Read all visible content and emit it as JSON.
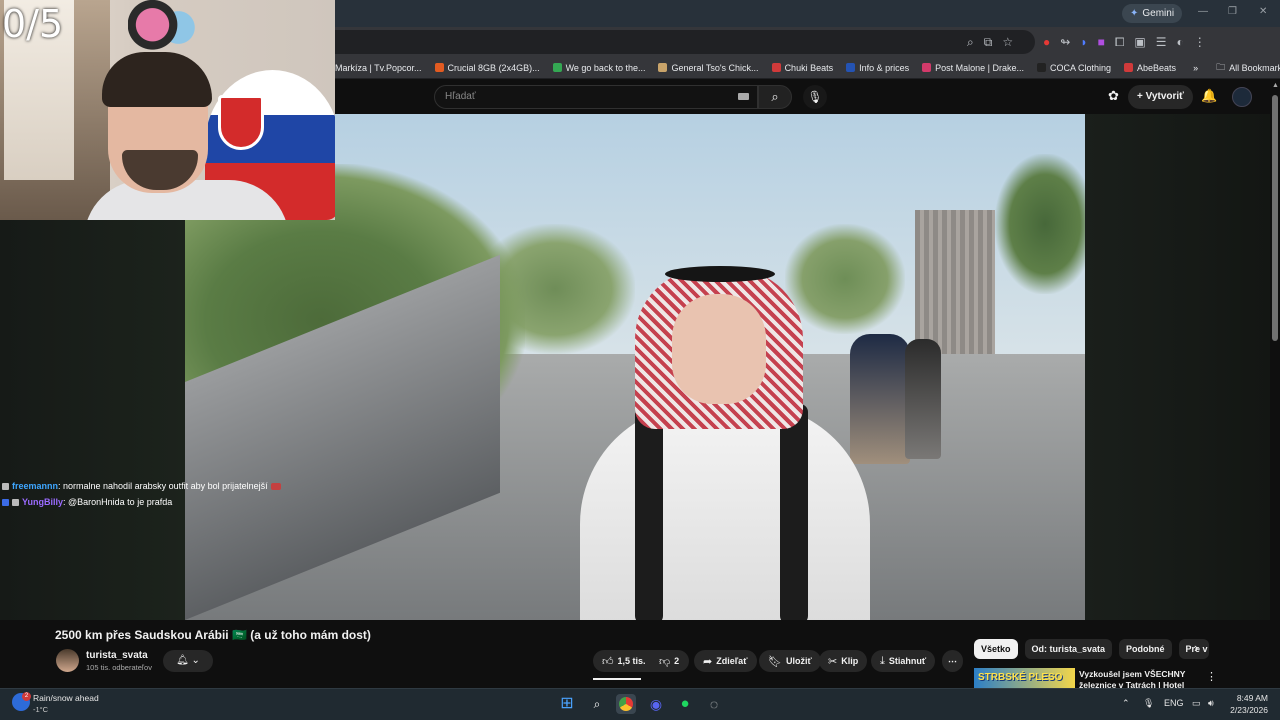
{
  "overlay": {
    "counter": "0/5"
  },
  "browser": {
    "gemini_label": "Gemini",
    "bookmarks": [
      {
        "label": "Markíza | Tv.Popcor...",
        "color": "#3aa1e0"
      },
      {
        "label": "Crucial 8GB (2x4GB)...",
        "color": "#e25b21"
      },
      {
        "label": "We go back to the...",
        "color": "#34a853"
      },
      {
        "label": "General Tso's Chick...",
        "color": "#c9a46a"
      },
      {
        "label": "Chuki Beats",
        "color": "#d03a3a"
      },
      {
        "label": "Info & prices",
        "color": "#2453b3"
      },
      {
        "label": "Post Malone | Drake...",
        "color": "#d23a6a"
      },
      {
        "label": "COCA Clothing",
        "color": "#222222"
      },
      {
        "label": "AbeBeats",
        "color": "#d03a3a"
      }
    ],
    "all_bookmarks": "All Bookmarks"
  },
  "youtube": {
    "search_placeholder": "Hľadať",
    "create_label": "Vytvoriť",
    "video_title": "2500 km přes Saudskou Arábii 🇸🇦 (a už toho mám dost)",
    "channel_name": "turista_svata",
    "channel_subs": "105 tis. odberateľov",
    "likes": "1,5 tis.",
    "dislikes": "2",
    "share": "Zdieľať",
    "save": "Uložiť",
    "clip": "Klip",
    "download": "Stiahnuť",
    "chips": [
      "Všetko",
      "Od: turista_svata",
      "Podobné",
      "Pre v"
    ],
    "rec_thumb_text": "STRBSKÉ PLESO",
    "rec_title": "Vyzkoušel jsem VŠECHNY železnice v Tatrách | Hotel"
  },
  "chat": [
    {
      "user": "freemannn",
      "message": ": normalne nahodil arabsky outfit aby bol prijatelnejší"
    },
    {
      "user": "YungBilly",
      "message": ": @BaronHnida to je prafda"
    }
  ],
  "taskbar": {
    "weather_title": "Rain/snow ahead",
    "weather_temp": "-1°C",
    "weather_badge": "2",
    "lang": "ENG",
    "time": "8:49 AM",
    "date": "2/23/2026"
  }
}
